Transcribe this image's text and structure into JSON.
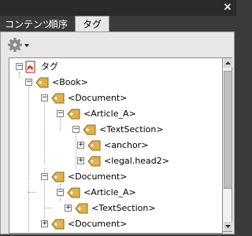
{
  "window": {
    "close_label": "×"
  },
  "tabs": [
    {
      "label": "コンテンツ"
    },
    {
      "label": "順序"
    },
    {
      "label": "タグ"
    }
  ],
  "toolbar": {
    "options_icon": "gear-icon"
  },
  "tree": {
    "root": {
      "label": "タグ",
      "icon": "pdf-icon"
    },
    "nodes": [
      {
        "label": "<Book>"
      },
      {
        "label": "<Document>"
      },
      {
        "label": "<Article_A>"
      },
      {
        "label": "<TextSection>"
      },
      {
        "label": "<anchor>"
      },
      {
        "label": "<legal.head2>"
      },
      {
        "label": "<Document>"
      },
      {
        "label": "<Article_A>"
      },
      {
        "label": "<TextSection>"
      },
      {
        "label": "<Document>"
      }
    ],
    "expanders": [
      "−",
      "−",
      "−",
      "−",
      "−",
      "+",
      "+",
      "−",
      "−",
      "+",
      "+"
    ]
  }
}
